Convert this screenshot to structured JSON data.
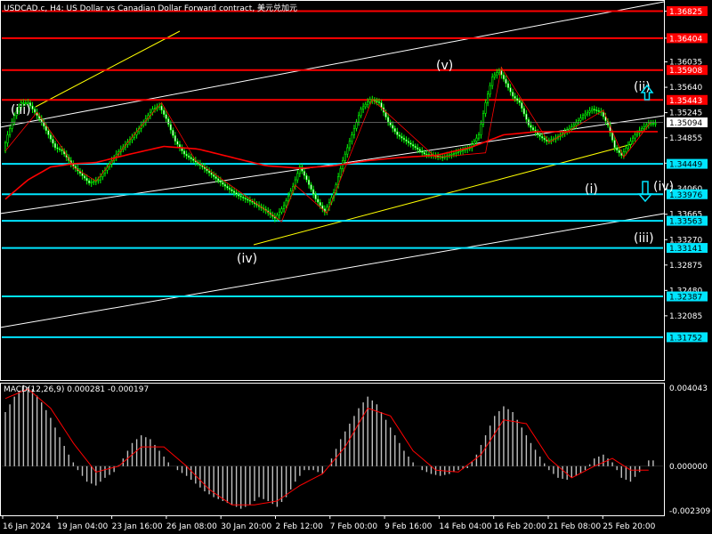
{
  "chart_data": {
    "type": "candlestick",
    "symbol_title": "USDCAD.c, H4: US Dollar vs Canadian Dollar Forward contract, 美元兑加元",
    "price_axis": {
      "range": [
        1.311,
        1.3697
      ],
      "ticks": [
        "1.36825",
        "1.36404",
        "1.36035",
        "1.35640",
        "1.35245",
        "1.34855",
        "1.34460",
        "1.34060",
        "1.33665",
        "1.33270",
        "1.32875",
        "1.32480",
        "1.32085"
      ],
      "tick_values": [
        1.36825,
        1.36404,
        1.36035,
        1.3564,
        1.35245,
        1.34855,
        1.3446,
        1.3406,
        1.33665,
        1.3327,
        1.32875,
        1.3248,
        1.32085
      ]
    },
    "horizontal_levels": [
      {
        "label": "1.36825",
        "value": 1.36825,
        "color": "#ff0000"
      },
      {
        "label": "1.36404",
        "value": 1.36404,
        "color": "#ff0000"
      },
      {
        "label": "1.35908",
        "value": 1.35908,
        "color": "#ff0000"
      },
      {
        "label": "1.35443",
        "value": 1.35443,
        "color": "#ff0000"
      },
      {
        "label": "1.34449",
        "value": 1.34449,
        "color": "#00e5ff"
      },
      {
        "label": "1.33976",
        "value": 1.33976,
        "color": "#00e5ff"
      },
      {
        "label": "1.33563",
        "value": 1.33563,
        "color": "#00e5ff"
      },
      {
        "label": "1.33141",
        "value": 1.33141,
        "color": "#00e5ff"
      },
      {
        "label": "1.32387",
        "value": 1.32387,
        "color": "#00e5ff"
      },
      {
        "label": "1.31752",
        "value": 1.31752,
        "color": "#00e5ff"
      }
    ],
    "current_price": {
      "label": "1.35094",
      "value": 1.35094
    },
    "time_labels": [
      "16 Jan 2024",
      "19 Jan 04:00",
      "23 Jan 16:00",
      "26 Jan 08:00",
      "30 Jan 20:00",
      "2 Feb 12:00",
      "7 Feb 00:00",
      "9 Feb 16:00",
      "14 Feb 04:00",
      "16 Feb 20:00",
      "21 Feb 08:00",
      "25 Feb 20:00"
    ],
    "wave_labels": [
      "(iii)",
      "(iv)",
      "(v)",
      "(i)",
      "(ii)",
      "(iii)",
      "(iv)"
    ],
    "price_series": [
      [
        0,
        1.3465
      ],
      [
        2,
        1.349
      ],
      [
        5,
        1.352
      ],
      [
        8,
        1.354
      ],
      [
        11,
        1.354
      ],
      [
        14,
        1.3525
      ],
      [
        17,
        1.351
      ],
      [
        20,
        1.349
      ],
      [
        23,
        1.347
      ],
      [
        26,
        1.3465
      ],
      [
        30,
        1.3445
      ],
      [
        34,
        1.343
      ],
      [
        38,
        1.3415
      ],
      [
        42,
        1.342
      ],
      [
        46,
        1.344
      ],
      [
        50,
        1.346
      ],
      [
        54,
        1.3475
      ],
      [
        58,
        1.349
      ],
      [
        62,
        1.351
      ],
      [
        66,
        1.353
      ],
      [
        69,
        1.3535
      ],
      [
        72,
        1.3515
      ],
      [
        76,
        1.348
      ],
      [
        80,
        1.346
      ],
      [
        84,
        1.345
      ],
      [
        88,
        1.344
      ],
      [
        93,
        1.3425
      ],
      [
        98,
        1.341
      ],
      [
        104,
        1.3395
      ],
      [
        110,
        1.3385
      ],
      [
        116,
        1.3372
      ],
      [
        120,
        1.336
      ],
      [
        124,
        1.338
      ],
      [
        128,
        1.341
      ],
      [
        131,
        1.344
      ],
      [
        134,
        1.342
      ],
      [
        138,
        1.339
      ],
      [
        142,
        1.337
      ],
      [
        146,
        1.34
      ],
      [
        150,
        1.345
      ],
      [
        154,
        1.349
      ],
      [
        158,
        1.353
      ],
      [
        162,
        1.3545
      ],
      [
        166,
        1.354
      ],
      [
        170,
        1.351
      ],
      [
        174,
        1.349
      ],
      [
        178,
        1.348
      ],
      [
        182,
        1.347
      ],
      [
        186,
        1.346
      ],
      [
        190,
        1.3458
      ],
      [
        194,
        1.3455
      ],
      [
        198,
        1.346
      ],
      [
        202,
        1.3465
      ],
      [
        206,
        1.347
      ],
      [
        210,
        1.349
      ],
      [
        213,
        1.354
      ],
      [
        216,
        1.358
      ],
      [
        219,
        1.359
      ],
      [
        222,
        1.357
      ],
      [
        225,
        1.355
      ],
      [
        228,
        1.354
      ],
      [
        232,
        1.3505
      ],
      [
        236,
        1.349
      ],
      [
        240,
        1.348
      ],
      [
        244,
        1.3485
      ],
      [
        248,
        1.3495
      ],
      [
        252,
        1.3505
      ],
      [
        256,
        1.352
      ],
      [
        260,
        1.353
      ],
      [
        264,
        1.3525
      ],
      [
        267,
        1.3505
      ],
      [
        270,
        1.347
      ],
      [
        273,
        1.3458
      ],
      [
        276,
        1.3475
      ],
      [
        279,
        1.349
      ],
      [
        282,
        1.35
      ],
      [
        285,
        1.3508
      ]
    ],
    "ma_series": [
      [
        0,
        1.339
      ],
      [
        10,
        1.342
      ],
      [
        20,
        1.344
      ],
      [
        30,
        1.3445
      ],
      [
        40,
        1.3447
      ],
      [
        55,
        1.346
      ],
      [
        70,
        1.3472
      ],
      [
        85,
        1.3468
      ],
      [
        100,
        1.3455
      ],
      [
        115,
        1.3442
      ],
      [
        130,
        1.3438
      ],
      [
        145,
        1.3442
      ],
      [
        160,
        1.345
      ],
      [
        175,
        1.3455
      ],
      [
        190,
        1.3458
      ],
      [
        205,
        1.347
      ],
      [
        220,
        1.349
      ],
      [
        235,
        1.3495
      ],
      [
        250,
        1.3495
      ],
      [
        265,
        1.3495
      ],
      [
        285,
        1.3495
      ]
    ],
    "macd": {
      "label": "MACD(12,26,9) 0.000281 -0.000197",
      "axis_ticks": [
        "0.004043",
        "0.000000",
        "-0.002309"
      ],
      "range": [
        -0.002309,
        0.004043
      ],
      "histogram": [
        [
          0,
          0.0028
        ],
        [
          4,
          0.0036
        ],
        [
          8,
          0.0042
        ],
        [
          12,
          0.004
        ],
        [
          16,
          0.0033
        ],
        [
          20,
          0.0025
        ],
        [
          24,
          0.0015
        ],
        [
          28,
          0.0006
        ],
        [
          32,
          -0.0002
        ],
        [
          36,
          -0.0008
        ],
        [
          40,
          -0.001
        ],
        [
          44,
          -0.0006
        ],
        [
          48,
          -0.0003
        ],
        [
          52,
          0.0004
        ],
        [
          56,
          0.0012
        ],
        [
          60,
          0.0016
        ],
        [
          64,
          0.0014
        ],
        [
          68,
          0.0008
        ],
        [
          72,
          0.0002
        ],
        [
          76,
          -0.0002
        ],
        [
          80,
          -0.0005
        ],
        [
          84,
          -0.0009
        ],
        [
          88,
          -0.0013
        ],
        [
          92,
          -0.0016
        ],
        [
          96,
          -0.0018
        ],
        [
          100,
          -0.002
        ],
        [
          104,
          -0.0022
        ],
        [
          108,
          -0.002
        ],
        [
          112,
          -0.0016
        ],
        [
          116,
          -0.0018
        ],
        [
          120,
          -0.0021
        ],
        [
          124,
          -0.0016
        ],
        [
          128,
          -0.0008
        ],
        [
          132,
          -0.0002
        ],
        [
          136,
          -0.0002
        ],
        [
          140,
          -0.0004
        ],
        [
          144,
          0.0004
        ],
        [
          148,
          0.0014
        ],
        [
          152,
          0.0022
        ],
        [
          156,
          0.003
        ],
        [
          160,
          0.0036
        ],
        [
          164,
          0.0032
        ],
        [
          168,
          0.0024
        ],
        [
          172,
          0.0016
        ],
        [
          176,
          0.0008
        ],
        [
          180,
          0.0002
        ],
        [
          184,
          -0.0002
        ],
        [
          188,
          -0.0004
        ],
        [
          192,
          -0.0005
        ],
        [
          196,
          -0.0004
        ],
        [
          200,
          -0.0002
        ],
        [
          204,
          -0.0001
        ],
        [
          208,
          0.0006
        ],
        [
          212,
          0.0016
        ],
        [
          216,
          0.0026
        ],
        [
          220,
          0.0031
        ],
        [
          224,
          0.0028
        ],
        [
          228,
          0.002
        ],
        [
          232,
          0.0012
        ],
        [
          236,
          0.0005
        ],
        [
          240,
          -0.0002
        ],
        [
          244,
          -0.0006
        ],
        [
          248,
          -0.0007
        ],
        [
          252,
          -0.0005
        ],
        [
          256,
          -0.0002
        ],
        [
          260,
          0.0004
        ],
        [
          264,
          0.0006
        ],
        [
          268,
          0.0002
        ],
        [
          272,
          -0.0006
        ],
        [
          276,
          -0.0008
        ],
        [
          280,
          -0.0003
        ],
        [
          284,
          0.0003
        ]
      ],
      "signal": [
        [
          0,
          0.0035
        ],
        [
          10,
          0.004
        ],
        [
          20,
          0.003
        ],
        [
          30,
          0.0012
        ],
        [
          40,
          -0.0003
        ],
        [
          50,
          0.0
        ],
        [
          60,
          0.001
        ],
        [
          70,
          0.001
        ],
        [
          80,
          0.0
        ],
        [
          90,
          -0.0012
        ],
        [
          100,
          -0.002
        ],
        [
          110,
          -0.002
        ],
        [
          120,
          -0.0018
        ],
        [
          130,
          -0.001
        ],
        [
          140,
          -0.0004
        ],
        [
          150,
          0.001
        ],
        [
          160,
          0.003
        ],
        [
          170,
          0.0026
        ],
        [
          180,
          0.0008
        ],
        [
          190,
          -0.0002
        ],
        [
          200,
          -0.0003
        ],
        [
          210,
          0.0006
        ],
        [
          220,
          0.0024
        ],
        [
          230,
          0.0022
        ],
        [
          240,
          0.0004
        ],
        [
          250,
          -0.0006
        ],
        [
          260,
          0.0
        ],
        [
          268,
          0.0004
        ],
        [
          276,
          -0.0002
        ],
        [
          285,
          -0.0002
        ]
      ]
    }
  }
}
